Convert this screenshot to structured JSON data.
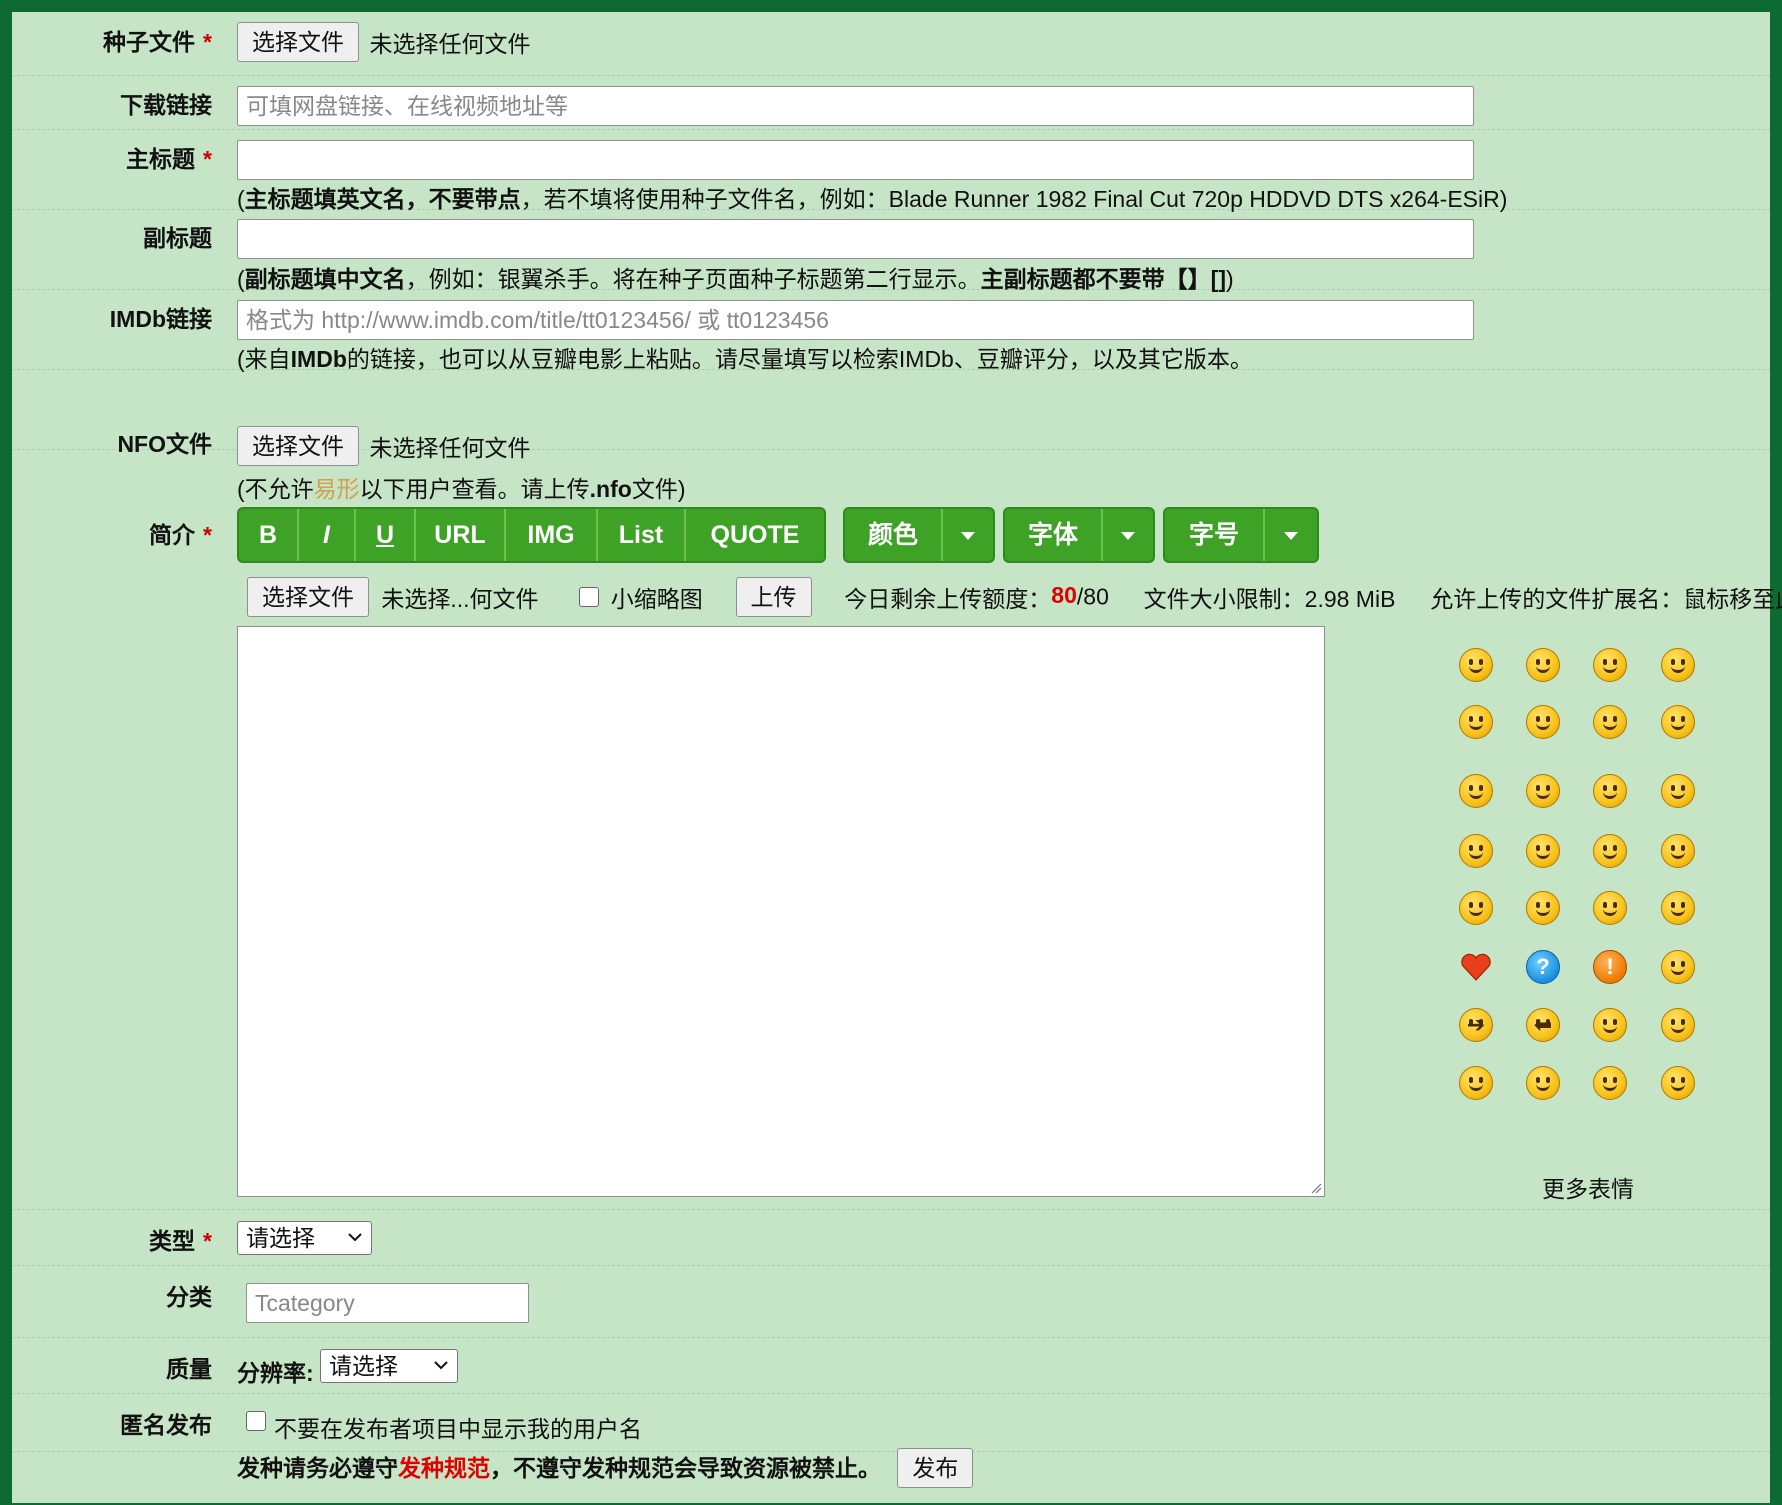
{
  "form": {
    "torrent_file": {
      "label": "种子文件",
      "required": "*",
      "button": "选择文件",
      "status": "未选择任何文件"
    },
    "download_link": {
      "label": "下载链接",
      "placeholder": "可填网盘链接、在线视频地址等"
    },
    "main_title": {
      "label": "主标题",
      "required": "*",
      "hint_prefix": "(",
      "hint_bold": "主标题填英文名，不要带点",
      "hint_rest": "，若不填将使用种子文件名，例如：Blade Runner 1982 Final Cut 720p HDDVD DTS x264-ESiR)"
    },
    "sub_title": {
      "label": "副标题",
      "hint_prefix": "(",
      "hint_bold1": "副标题填中文名",
      "hint_mid": "，例如：银翼杀手。将在种子页面种子标题第二行显示。",
      "hint_bold2": "主副标题都不要带【】[]",
      "hint_suffix": ")"
    },
    "imdb": {
      "label": "IMDb链接",
      "placeholder": "格式为 http://www.imdb.com/title/tt0123456/ 或 tt0123456",
      "hint_prefix": "(来自",
      "hint_bold": "IMDb",
      "hint_rest": "的链接，也可以从豆瓣电影上粘贴。请尽量填写以检索IMDb、豆瓣评分，以及其它版本。"
    },
    "nfo": {
      "label": "NFO文件",
      "button": "选择文件",
      "status": "未选择任何文件",
      "hint_prefix": "(不允许",
      "hint_orange": "易形",
      "hint_mid": "以下用户查看。请上传",
      "hint_bold": ".nfo",
      "hint_suffix": "文件)"
    },
    "description": {
      "label": "简介",
      "required": "*",
      "toolbar": {
        "bold": "B",
        "italic": "I",
        "underline": "U",
        "url": "URL",
        "img": "IMG",
        "list": "List",
        "quote": "QUOTE",
        "color": "颜色",
        "font": "字体",
        "size": "字号"
      },
      "upload": {
        "button": "选择文件",
        "status": "未选择...何文件",
        "thumb_label": "小缩略图",
        "upload_button": "上传",
        "quota_label": "今日剩余上传额度：",
        "quota_remaining": "80",
        "quota_total": "/80",
        "size_limit": "文件大小限制：2.98 MiB",
        "ext_label": "允许上传的文件扩展名：鼠标移至此"
      },
      "more_smilies": "更多表情"
    },
    "type": {
      "label": "类型",
      "required": "*",
      "selected": "请选择"
    },
    "category": {
      "label": "分类",
      "placeholder": "Tcategory"
    },
    "quality": {
      "label": "质量",
      "resolution_label": "分辨率:",
      "selected": "请选择"
    },
    "anonymous": {
      "label": "匿名发布",
      "checkbox_label": "不要在发布者项目中显示我的用户名"
    },
    "footer": {
      "notice_prefix": "发种请务必遵守",
      "notice_link": "发种规范",
      "notice_suffix": "，不遵守发种规范会导致资源被禁止。",
      "submit": "发布"
    }
  },
  "colors": {
    "accent_green": "#3ea226",
    "background": "#c6e4c6",
    "border": "#0e6a33",
    "required_red": "#d00000"
  }
}
